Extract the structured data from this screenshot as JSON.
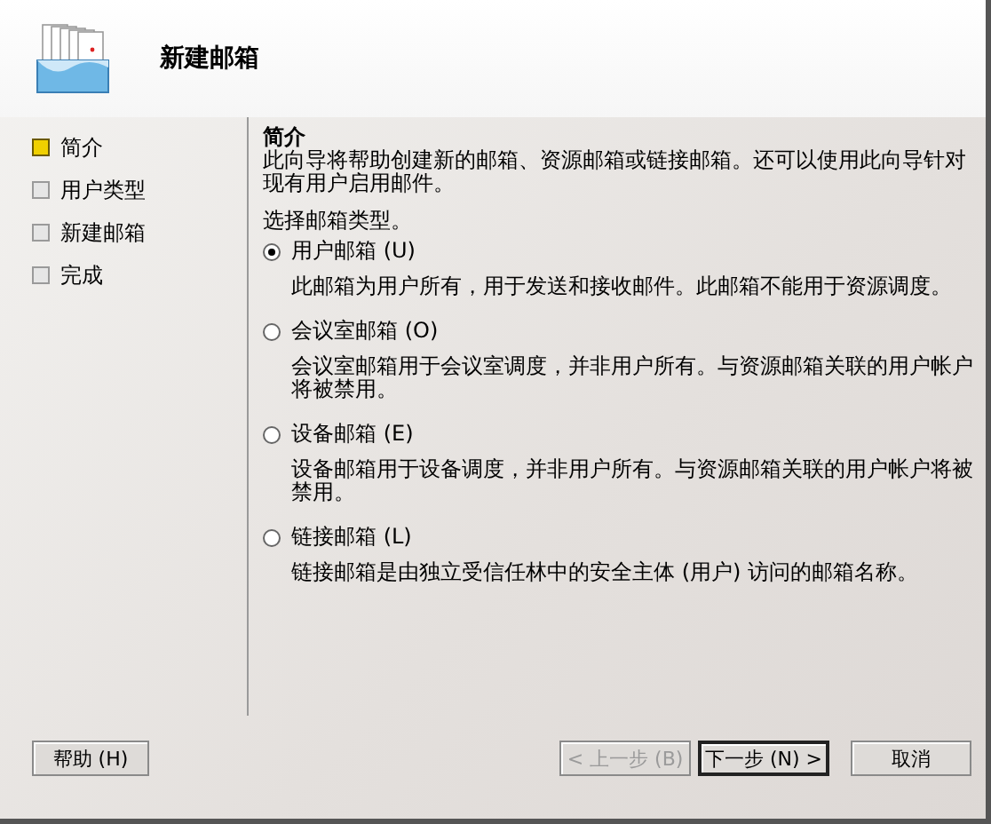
{
  "header": {
    "title": "新建邮箱"
  },
  "steps": [
    {
      "label": "简介",
      "selected": true
    },
    {
      "label": "用户类型",
      "selected": false
    },
    {
      "label": "新建邮箱",
      "selected": false
    },
    {
      "label": "完成",
      "selected": false
    }
  ],
  "section_title": "简介",
  "intro": "此向导将帮助创建新的邮箱、资源邮箱或链接邮箱。还可以使用此向导针对现有用户启用邮件。",
  "prompt": "选择邮箱类型。",
  "options": [
    {
      "label": "用户邮箱 (U)",
      "selected": true,
      "description": "此邮箱为用户所有，用于发送和接收邮件。此邮箱不能用于资源调度。"
    },
    {
      "label": "会议室邮箱 (O)",
      "selected": false,
      "description": "会议室邮箱用于会议室调度，并非用户所有。与资源邮箱关联的用户帐户将被禁用。"
    },
    {
      "label": "设备邮箱 (E)",
      "selected": false,
      "description": "设备邮箱用于设备调度，并非用户所有。与资源邮箱关联的用户帐户将被禁用。"
    },
    {
      "label": "链接邮箱 (L)",
      "selected": false,
      "description": "链接邮箱是由独立受信任林中的安全主体 (用户) 访问的邮箱名称。"
    }
  ],
  "help_button": {
    "label": "帮助 (H)"
  },
  "buttons": [
    {
      "label": "< 上一步 (B)",
      "disabled": true,
      "default": false
    },
    {
      "label": "下一步 (N) >",
      "disabled": false,
      "default": true
    },
    {
      "label": "取消",
      "disabled": false,
      "default": false
    }
  ]
}
